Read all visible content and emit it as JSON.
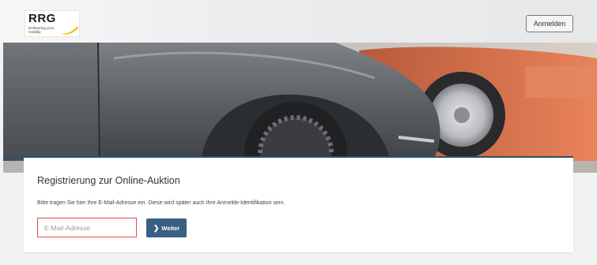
{
  "header": {
    "logo": {
      "mark": "RRG",
      "tagline": "Embracing your mobility"
    },
    "login_label": "Anmelden"
  },
  "registration": {
    "title": "Registrierung zur Online-Auktion",
    "info": "Bitte tragen Sie hier Ihre E-Mail-Adresse ein. Diese wird später auch Ihre Anmelde-Identifikation sein.",
    "email": {
      "value": "",
      "placeholder": "E-Mail-Adresse"
    },
    "next_label": "Weiter"
  },
  "colors": {
    "accent": "#3a5f84",
    "input_error_border": "#d9534f",
    "logo_swoosh": "#f2c200"
  },
  "icons": {
    "next": "chevron-right-icon"
  }
}
